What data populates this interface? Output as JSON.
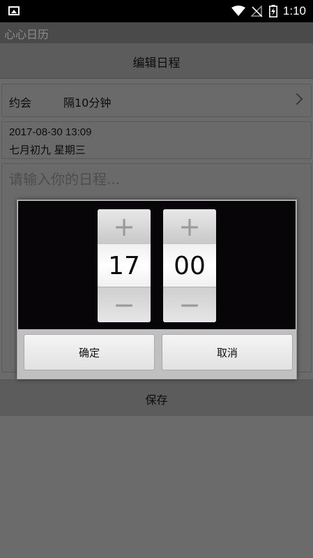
{
  "status_bar": {
    "time": "1:10",
    "icons": [
      "image-icon",
      "wifi-icon",
      "no-signal-icon",
      "battery-charging-icon"
    ]
  },
  "app": {
    "title": "心心日历"
  },
  "header": {
    "title": "编辑日程"
  },
  "schedule": {
    "type_label": "约会",
    "reminder": "隔10分钟",
    "datetime": "2017-08-30 13:09",
    "lunar_date": "七月初九 星期三",
    "note_placeholder": "请输入你的日程..."
  },
  "time_picker": {
    "hour": "17",
    "minute": "00",
    "increment_symbol": "+",
    "decrement_symbol": "−",
    "ok_label": "确定",
    "cancel_label": "取消"
  },
  "footer": {
    "save_label": "保存"
  }
}
